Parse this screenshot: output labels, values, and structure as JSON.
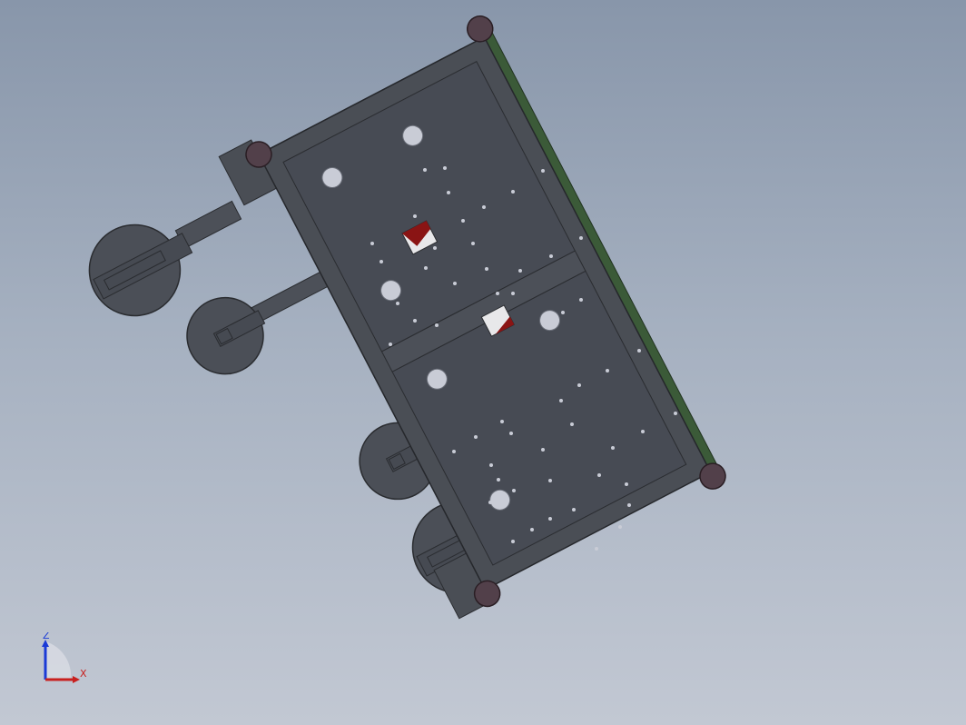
{
  "viewport": {
    "background_top": "#8896aa",
    "background_bottom": "#c2c8d3"
  },
  "model": {
    "frame_color": "#4a4e55",
    "plate_color": "#474b54",
    "edge_strip_color": "#3b5a38",
    "corner_pad_color": "#52404a",
    "hole_color": "#c9ccd6",
    "red_part_color": "#8a1414"
  },
  "triad": {
    "z_label": "Z",
    "x_label": "X",
    "z_color": "#1a3ad6",
    "x_color": "#c8201e"
  }
}
